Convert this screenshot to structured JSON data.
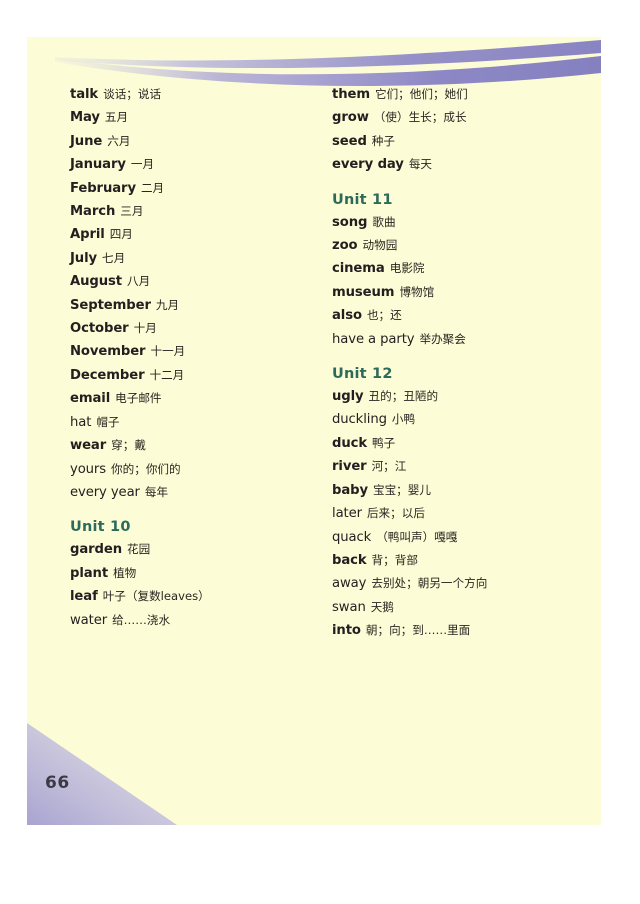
{
  "page": {
    "folio": "66",
    "background_color": "#fcfcd6",
    "ornament_color": "#9a96cc",
    "unit_heading_color": "#2c6a5b",
    "text_color": "#231f20"
  },
  "ornaments": {
    "header_name": "purple-swoosh-band",
    "footer_name": "purple-corner-wedge"
  },
  "columns": [
    {
      "name": "left-column",
      "groups": [
        {
          "heading": null,
          "entries": [
            {
              "word": "talk",
              "gloss": "谈话；说话",
              "weight": "bold"
            },
            {
              "word": "May",
              "gloss": "五月",
              "weight": "bold"
            },
            {
              "word": "June",
              "gloss": "六月",
              "weight": "bold"
            },
            {
              "word": "January",
              "gloss": "一月",
              "weight": "bold"
            },
            {
              "word": "February",
              "gloss": "二月",
              "weight": "bold"
            },
            {
              "word": "March",
              "gloss": "三月",
              "weight": "bold"
            },
            {
              "word": "April",
              "gloss": "四月",
              "weight": "bold"
            },
            {
              "word": "July",
              "gloss": "七月",
              "weight": "bold"
            },
            {
              "word": "August",
              "gloss": "八月",
              "weight": "bold"
            },
            {
              "word": "September",
              "gloss": "九月",
              "weight": "bold"
            },
            {
              "word": "October",
              "gloss": "十月",
              "weight": "bold"
            },
            {
              "word": "November",
              "gloss": "十一月",
              "weight": "bold"
            },
            {
              "word": "December",
              "gloss": "十二月",
              "weight": "bold"
            },
            {
              "word": "email",
              "gloss": "电子邮件",
              "weight": "bold"
            },
            {
              "word": "hat",
              "gloss": "帽子",
              "weight": "light"
            },
            {
              "word": "wear",
              "gloss": "穿；戴",
              "weight": "bold"
            },
            {
              "word": "yours",
              "gloss": "你的；你们的",
              "weight": "light"
            },
            {
              "word": "every year",
              "gloss": "每年",
              "weight": "light"
            }
          ]
        },
        {
          "heading": "Unit 10",
          "entries": [
            {
              "word": "garden",
              "gloss": "花园",
              "weight": "bold"
            },
            {
              "word": "plant",
              "gloss": "植物",
              "weight": "bold"
            },
            {
              "word": "leaf",
              "gloss": "叶子（复数leaves）",
              "weight": "bold"
            },
            {
              "word": "water",
              "gloss": "给……浇水",
              "weight": "light"
            }
          ]
        }
      ]
    },
    {
      "name": "right-column",
      "groups": [
        {
          "heading": null,
          "entries": [
            {
              "word": "them",
              "gloss": "它们；他们；她们",
              "weight": "bold"
            },
            {
              "word": "grow",
              "gloss": "（使）生长；成长",
              "weight": "bold"
            },
            {
              "word": "seed",
              "gloss": "种子",
              "weight": "bold"
            },
            {
              "word": "every day",
              "gloss": "每天",
              "weight": "bold"
            }
          ]
        },
        {
          "heading": "Unit 11",
          "entries": [
            {
              "word": "song",
              "gloss": "歌曲",
              "weight": "bold"
            },
            {
              "word": "zoo",
              "gloss": "动物园",
              "weight": "bold"
            },
            {
              "word": "cinema",
              "gloss": "电影院",
              "weight": "bold"
            },
            {
              "word": "museum",
              "gloss": "博物馆",
              "weight": "bold"
            },
            {
              "word": "also",
              "gloss": "也；还",
              "weight": "bold"
            },
            {
              "word": "have a party",
              "gloss": "举办聚会",
              "weight": "light"
            }
          ]
        },
        {
          "heading": "Unit 12",
          "entries": [
            {
              "word": "ugly",
              "gloss": "丑的；丑陋的",
              "weight": "bold"
            },
            {
              "word": "duckling",
              "gloss": "小鸭",
              "weight": "light"
            },
            {
              "word": "duck",
              "gloss": "鸭子",
              "weight": "bold"
            },
            {
              "word": "river",
              "gloss": "河；江",
              "weight": "bold"
            },
            {
              "word": "baby",
              "gloss": "宝宝；婴儿",
              "weight": "bold"
            },
            {
              "word": "later",
              "gloss": "后来；以后",
              "weight": "light"
            },
            {
              "word": "quack",
              "gloss": "（鸭叫声）嘎嘎",
              "weight": "light"
            },
            {
              "word": "back",
              "gloss": "背；背部",
              "weight": "bold"
            },
            {
              "word": "away",
              "gloss": "去别处；朝另一个方向",
              "weight": "light"
            },
            {
              "word": "swan",
              "gloss": "天鹅",
              "weight": "light"
            },
            {
              "word": "into",
              "gloss": "朝；向；到……里面",
              "weight": "bold"
            }
          ]
        }
      ]
    }
  ]
}
